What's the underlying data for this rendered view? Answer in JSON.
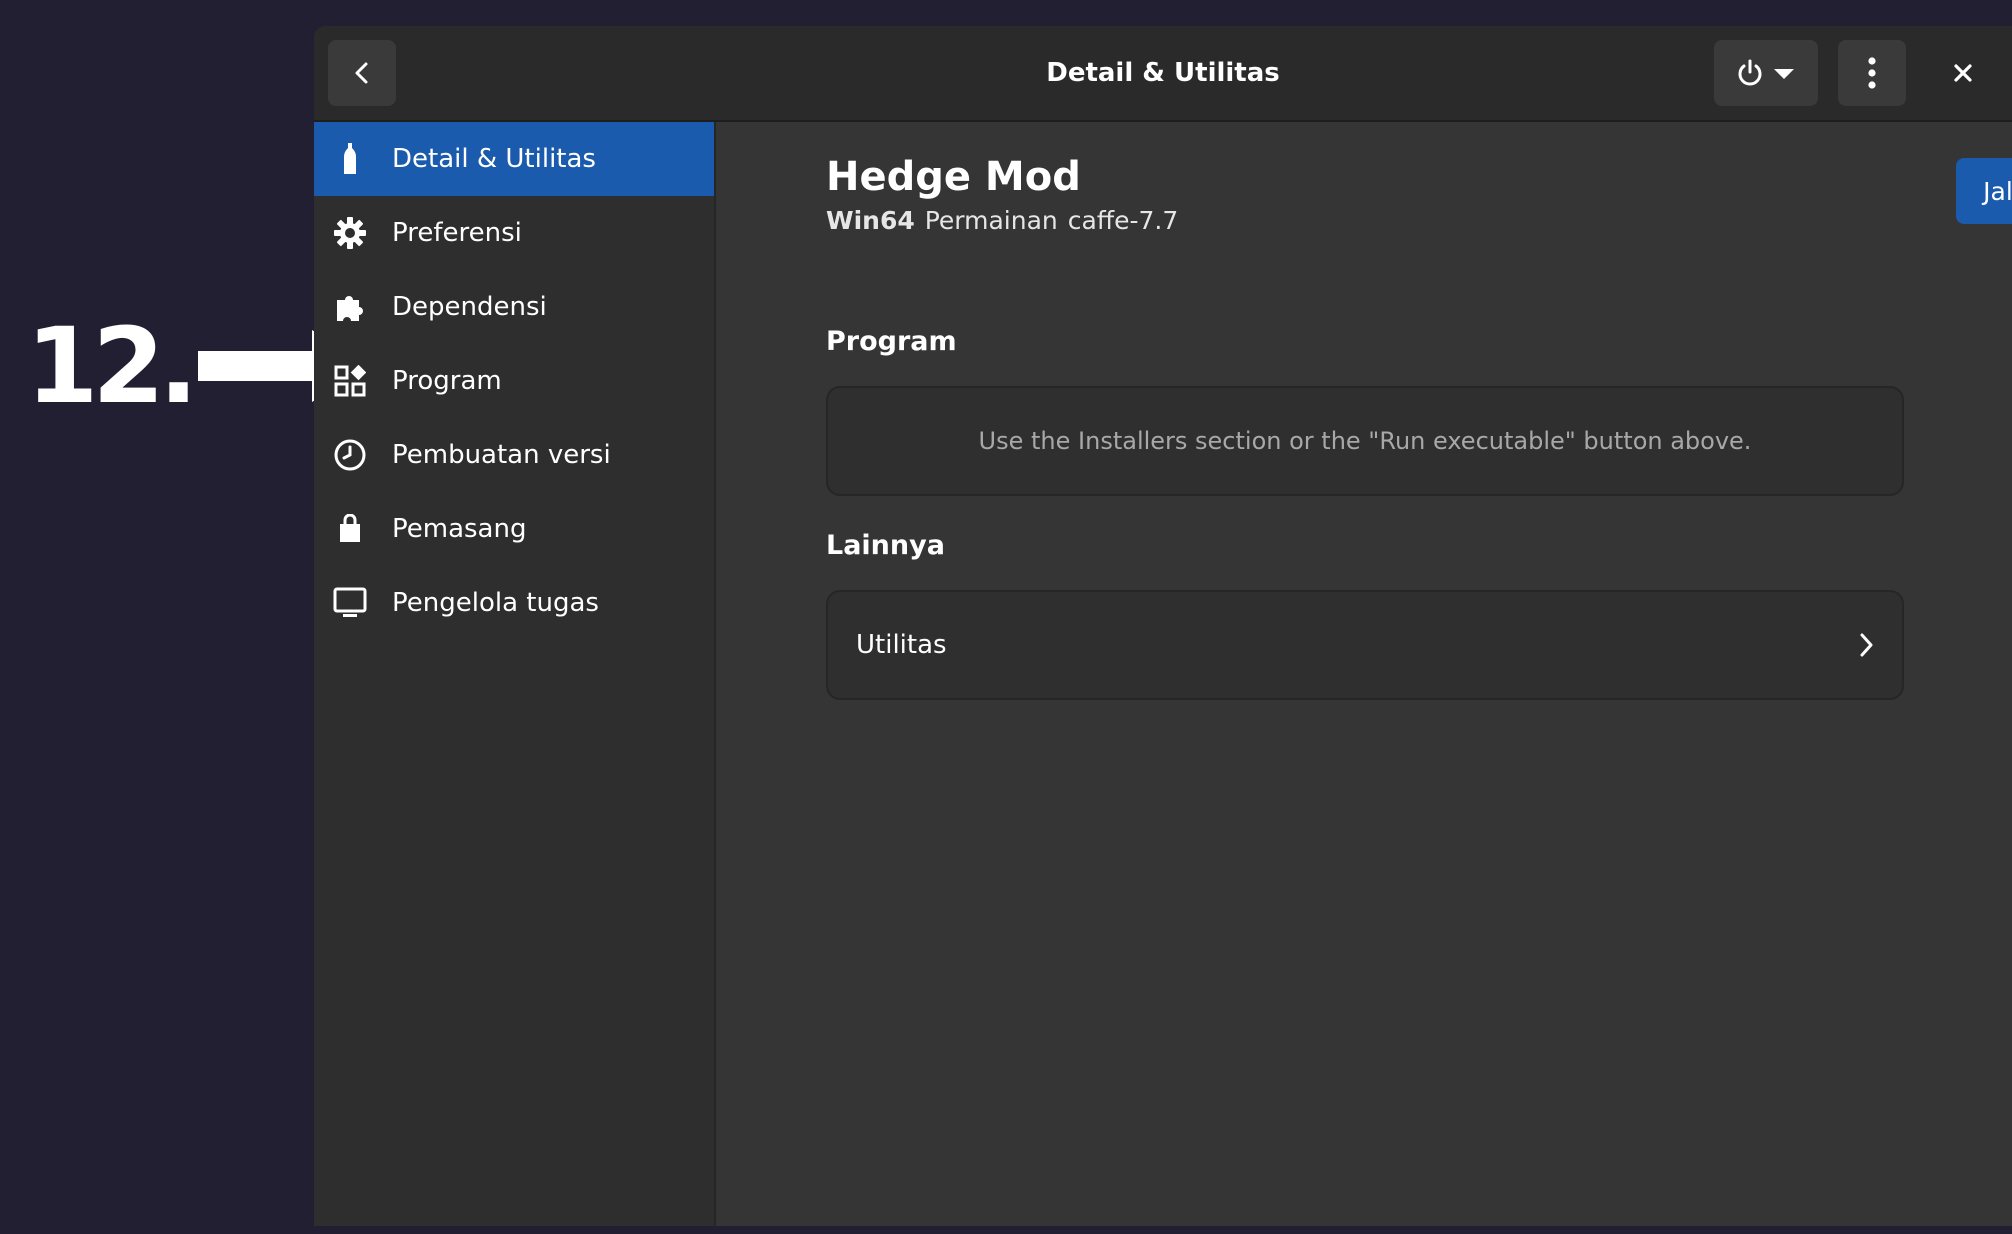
{
  "annotation": {
    "step": "12."
  },
  "window": {
    "title": "Detail & Utilitas"
  },
  "sidebar": {
    "items": [
      {
        "label": "Detail & Utilitas",
        "icon": "bottle-icon",
        "active": true
      },
      {
        "label": "Preferensi",
        "icon": "gear-icon"
      },
      {
        "label": "Dependensi",
        "icon": "puzzle-icon"
      },
      {
        "label": "Program",
        "icon": "grid-icon"
      },
      {
        "label": "Pembuatan versi",
        "icon": "clock-icon"
      },
      {
        "label": "Pemasang",
        "icon": "bag-icon"
      },
      {
        "label": "Pengelola tugas",
        "icon": "monitor-icon"
      }
    ]
  },
  "main": {
    "app_name": "Hedge Mod",
    "arch": "Win64",
    "env": "Permainan",
    "runner": "caffe-7.7",
    "run_button": "Jalankan eksekusi",
    "programs_title": "Program",
    "programs_empty": "Use the Installers section or the \"Run executable\" button above.",
    "other_title": "Lainnya",
    "utilities_label": "Utilitas"
  },
  "colors": {
    "accent": "#1b5bad",
    "background": "#231f33",
    "window": "#353535",
    "sidebar": "#2e2e2e"
  }
}
